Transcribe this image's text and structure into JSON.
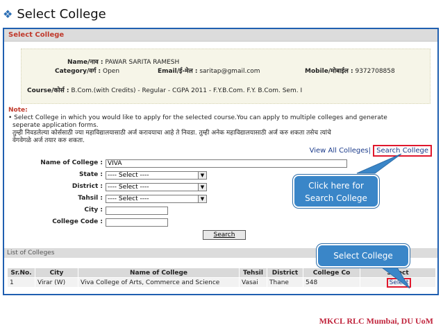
{
  "slide": {
    "title_bullet": "❖",
    "title": "Select College",
    "footer": "MKCL RLC Mumbai, DU UoM"
  },
  "app": {
    "section_title": "Select College",
    "profile": {
      "name_label": "Name/नाव :",
      "name_value": "PAWAR SARITA RAMESH",
      "category_label": "Category/वर्ग :",
      "category_value": "Open",
      "email_label": "Email/ई-मेल :",
      "email_value": "saritap@gmail.com",
      "mobile_label": "Mobile/मोबाईल :",
      "mobile_value": "9372708858",
      "course_label": "Course/कोर्स :",
      "course_value": "B.Com.(with Credits) - Regular - CGPA 2011 - F.Y.B.Com. F.Y. B.Com. Sem. I"
    },
    "note": {
      "heading": "Note:",
      "line1": "• Select College in which you would like to apply for the selected course.You can apply to multiple colleges and generate",
      "line2": "seperate application forms.",
      "line3": "तुम्ही निवडलेल्या कोर्ससाठी ज्या महाविद्यालयासाठी अर्ज करावयाचा आहे ते निवडा. तुम्ही अनेक महाविद्यालयासाठी अर्ज करु शकता तसेच त्यांचे",
      "line4": "वेगवेगळे अर्ज तयार करु शकता."
    },
    "links": {
      "view_all": "View All Colleges",
      "separator": "|",
      "search_college": "Search College"
    },
    "form": {
      "name_label": "Name of College :",
      "name_value": "VIVA",
      "state_label": "State :",
      "state_value": "---- Select ----",
      "district_label": "District :",
      "district_value": "---- Select ----",
      "tahsil_label": "Tahsil :",
      "tahsil_value": "---- Select ----",
      "city_label": "City :",
      "city_value": "",
      "code_label": "College Code :",
      "code_value": "",
      "search_button": "Search"
    },
    "list": {
      "heading": "List of Colleges",
      "columns": [
        "Sr.No.",
        "City",
        "Name of College",
        "Tehsil",
        "District",
        "College Co",
        "Select"
      ],
      "rows": [
        {
          "sr": "1",
          "city": "Virar (W)",
          "name": "Viva College of Arts, Commerce and Science",
          "tehsil": "Vasai",
          "district": "Thane",
          "code": "548",
          "select": "Select"
        }
      ]
    }
  },
  "callouts": {
    "search_line1": "Click here for",
    "search_line2": "Search College",
    "select": "Select College"
  },
  "colors": {
    "accent_blue": "#1f5fb0",
    "callout_blue": "#3a86c8",
    "highlight_red": "#e0182d",
    "footer_red": "#c0243c"
  }
}
